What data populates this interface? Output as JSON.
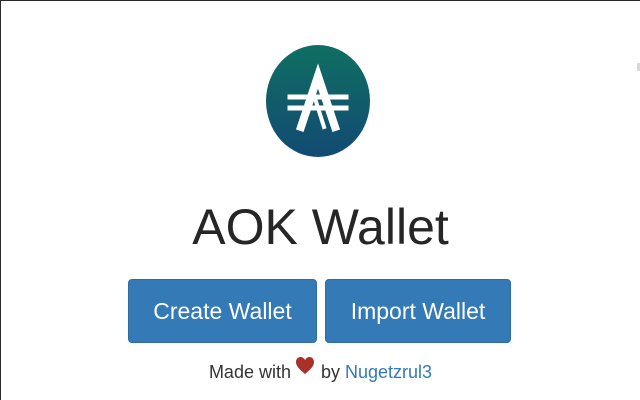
{
  "app": {
    "logo_icon": "aok-logo-icon",
    "title": "AOK Wallet"
  },
  "actions": {
    "create_label": "Create Wallet",
    "import_label": "Import Wallet"
  },
  "footer": {
    "made_with": "Made with",
    "heart_icon": "heart-icon",
    "by": "by",
    "author": "Nugetzrul3"
  },
  "colors": {
    "primary": "#337ab7",
    "logo_top": "#0f6f62",
    "logo_bottom": "#124a73",
    "heart": "#a8322a"
  }
}
